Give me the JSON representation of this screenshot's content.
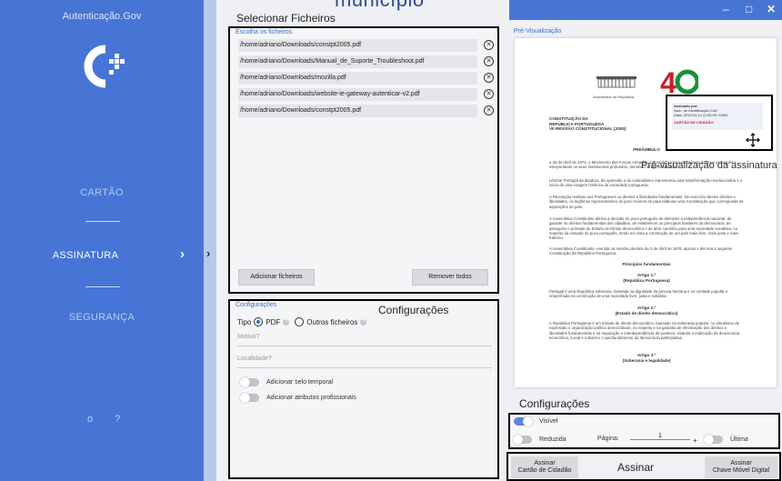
{
  "app": {
    "title": "Autenticação.Gov",
    "cut_header": "município"
  },
  "sidebar": {
    "items": [
      {
        "label": "CARTÃO"
      },
      {
        "label": "ASSINATURA"
      },
      {
        "label": "SEGURANÇA"
      }
    ],
    "active_arrow": "›",
    "bottom": {
      "info": "o",
      "help": "?"
    },
    "strip_arrow": "›"
  },
  "window": {
    "minimize": "–",
    "maximize": "□",
    "close": "✕"
  },
  "files": {
    "section_title": "Selecionar Ficheiros",
    "subtitle": "Escolha os ficheiros",
    "list": [
      "/home/adriano/Downloads/constpt2005.pdf",
      "/home/adriano/Downloads/Manual_de_Suporte_Troubleshoot.pdf",
      "/home/adriano/Downloads/mozilla.pdf",
      "/home/adriano/Downloads/website-ie-gateway-autenticar-v2.pdf",
      "/home/adriano/Downloads/constpt2005.pdf"
    ],
    "add_button": "Adicionar ficheiros",
    "remove_all_button": "Remover todos"
  },
  "config": {
    "subtitle": "Configurações",
    "overlay_label": "Configurações",
    "type_label": "Tipo",
    "pdf_option": "PDF",
    "other_option": "Outros ficheiros",
    "reason_placeholder": "Motivo?",
    "location_placeholder": "Localidade?",
    "timestamp_toggle": "Adicionar selo temporal",
    "attributes_toggle": "Adicionar atributos profissionais"
  },
  "preview": {
    "label": "Pré-Visualização",
    "overlay_label": "Pré-visualização da assinatura",
    "doc": {
      "assembly": "Assembleia da República",
      "heading": [
        "CONSTITUIÇÃO DA",
        "REPÚBLICA PORTUGUESA",
        "VII REVISÃO CONSTITUCIONAL [2005]"
      ],
      "preamble": "PREÂMBULO",
      "paragraphs": [
        "a 25 de Abril de 1974, o Movimento das Forças Armadas, coroando a longa resistência do povo português e interpretando os seus sentimentos profundos, derrubou o regime fascista.",
        "Libertar Portugal da ditadura, da opressão e do colonialismo representou uma transformação revolucionária e o início de uma viragem histórica da sociedade portuguesa.",
        "A Revolução restituiu aos Portugueses os direitos e liberdades fundamentais. No exercício destes direitos e liberdades, os legítimos representantes do povo reúnem-se para elaborar uma Constituição que corresponde às aspirações do país.",
        "A Assembleia Constituinte afirma a decisão do povo português de defender a independência nacional, de garantir os direitos fundamentais dos cidadãos, de estabelecer os princípios basilares da democracia, de assegurar o primado do Estado de Direito democrático e de abrir caminho para uma sociedade socialista, no respeito da vontade do povo português, tendo em vista a construção de um país mais livre, mais justo e mais fraterno.",
        "A Assembleia Constituinte, reunida na sessão plenária de 2 de Abril de 1976, aprova e decreta a seguinte Constituição da República Portuguesa:"
      ],
      "principles": "Princípios fundamentais",
      "art1_title": "Artigo 1.º",
      "art1_sub": "(República Portuguesa)",
      "art1_text": "Portugal é uma República soberana, baseada na dignidade da pessoa humana e na vontade popular e empenhada na construção de uma sociedade livre, justa e solidária.",
      "art2_title": "Artigo 2.º",
      "art2_sub": "(Estado de direito democrático)",
      "art2_text": "A República Portuguesa é um Estado de direito democrático, baseado na soberania popular, no pluralismo de expressão e organização política democráticas, no respeito e na garantia de efectivação dos direitos e liberdades fundamentais e na separação e interdependência de poderes, visando a realização da democracia económica, social e cultural e o aprofundamento da democracia participativa.",
      "art3_title": "Artigo 3.º",
      "art3_sub": "(Soberania e legalidade)"
    },
    "signature": {
      "line1": "Assinado por:",
      "line2": "Num. de Identificação Civil",
      "line3": "Data: 2019.03.14 11:53:05 +0000",
      "card": "CARTÃO DE CIDADÃO"
    }
  },
  "visibility": {
    "section_label": "Configurações",
    "visible_label": "Visível",
    "reduced_label": "Reduzida",
    "page_label": "Página:",
    "page_value": "1",
    "plus": "+",
    "last_label": "Última"
  },
  "sign": {
    "cc_line1": "Assinar",
    "cc_line2": "Cartão de Cidadão",
    "center_label": "Assinar",
    "cmd_line1": "Assinar",
    "cmd_line2": "Chave Móvel Digital"
  },
  "colors": {
    "sidebar": "#4675d6",
    "accent": "#3b6cc5",
    "highlight_box": "#000000"
  }
}
